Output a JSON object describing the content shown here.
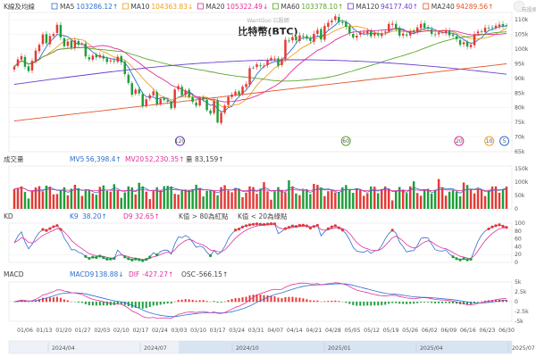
{
  "header": {
    "panel_label": "K線及均線",
    "ma": [
      {
        "label": "MA5",
        "value": "103286.12↑",
        "color": "#2f6fd0"
      },
      {
        "label": "MA10",
        "value": "104363.83↓",
        "color": "#f0a020"
      },
      {
        "label": "MA20",
        "value": "105322.49↓",
        "color": "#e0309a"
      },
      {
        "label": "MA60",
        "value": "103378.10↑",
        "color": "#5aa52c"
      },
      {
        "label": "MA120",
        "value": "94177.40↑",
        "color": "#6a3fd0"
      },
      {
        "label": "MA240",
        "value": "94289.56↑",
        "color": "#e0552a"
      }
    ]
  },
  "brand": {
    "watermark": "WantGoo 玩股網",
    "logo": "玩股網"
  },
  "chart_data": {
    "type": "candlestick",
    "title": "比特幣(BTC)",
    "price_axis": {
      "ticks": [
        "110k",
        "105k",
        "100k",
        "95k",
        "90k",
        "85k",
        "80k",
        "75k",
        "70k",
        "65k"
      ],
      "ylim": [
        65000,
        112500
      ]
    },
    "close_series": [
      94000,
      96500,
      97600,
      94000,
      92500,
      96000,
      99500,
      101500,
      105000,
      102000,
      104500,
      105200,
      108300,
      104000,
      101000,
      102600,
      100500,
      103000,
      101500,
      101800,
      97500,
      96500,
      97800,
      97200,
      98000,
      96800,
      95600,
      96200,
      95900,
      97400,
      95500,
      91500,
      88500,
      84500,
      86200,
      84900,
      80500,
      82900,
      84300,
      85600,
      81200,
      83000,
      82700,
      82100,
      79800,
      86200,
      87400,
      84300,
      85900,
      83700,
      82000,
      80700,
      83400,
      82900,
      79200,
      78000,
      82500,
      75000,
      78300,
      80700,
      83700,
      84500,
      85500,
      84500,
      87200,
      88100,
      93500,
      93700,
      94800,
      94300,
      94300,
      96300,
      97000,
      96800,
      94300,
      96700,
      103200,
      102800,
      104100,
      103000,
      104700,
      104200,
      103600,
      102800,
      105200,
      106500,
      103300,
      107900,
      109000,
      109700,
      111200,
      109300,
      108900,
      107600,
      105500,
      104000,
      104600,
      105700,
      105700,
      106100,
      104400,
      105500,
      104700,
      105400,
      106000,
      108600,
      108700,
      107000,
      104600,
      105300,
      104600,
      106000,
      105900,
      107400,
      108600,
      107300,
      107000,
      105200,
      104800,
      105700,
      105800,
      106300,
      104700,
      104500,
      103400,
      101500,
      102300,
      100900,
      101500,
      105100,
      106000,
      106100,
      107300,
      107100,
      107300,
      108000,
      108400,
      107900,
      108000
    ],
    "volume_panel": {
      "label": "成交量",
      "ma5_label": "MV5",
      "ma5_value": "56,398.4↑",
      "ma20_label": "MV20",
      "ma20_value": "52,230.35↑",
      "vol_label": "量",
      "vol_value": "83,159↑",
      "ticks": [
        "150k",
        "100k",
        "50k",
        "0"
      ]
    },
    "kd_panel": {
      "label": "KD",
      "k_label": "K9",
      "k_value": "38.20↑",
      "d_label": "D9",
      "d_value": "32.65↑",
      "note1": "K值 > 80為紅點",
      "note2": "K值 < 20為綠點",
      "ticks": [
        "100",
        "80",
        "60",
        "40",
        "20",
        "0"
      ]
    },
    "macd_panel": {
      "label": "MACD",
      "macd_label": "MACD9",
      "macd_value": "138.88↓",
      "dif_label": "DIF",
      "dif_value": "-427.27↑",
      "osc_label": "OSC",
      "osc_value": "-566.15↑",
      "ticks": [
        "5k",
        "2.5k",
        "0",
        "-2.5k",
        "-5k"
      ]
    },
    "x_ticks": [
      "01/06",
      "01/13",
      "01/20",
      "01/27",
      "02/03",
      "02/10",
      "02/17",
      "02/24",
      "03/03",
      "03/10",
      "03/17",
      "03/24",
      "03/31",
      "04/07",
      "04/14",
      "04/21",
      "04/28",
      "05/05",
      "05/12",
      "05/19",
      "05/26",
      "06/02",
      "06/09",
      "06/16",
      "06/23",
      "06/30"
    ],
    "timeline_labels": [
      "2024/04",
      "2024/07",
      "2024/10",
      "2025/01",
      "2025/04",
      "2025/07"
    ],
    "event_markers": [
      "120",
      "60",
      "20",
      "10",
      "5"
    ]
  }
}
